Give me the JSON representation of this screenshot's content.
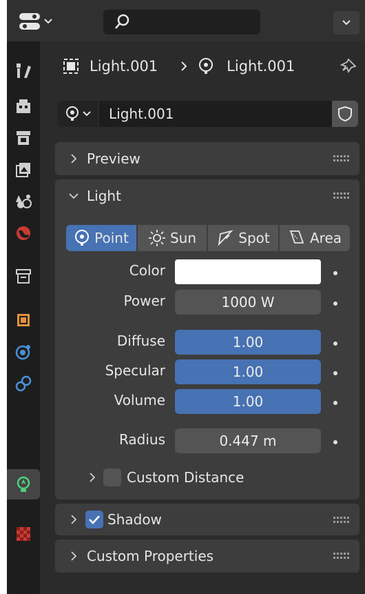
{
  "search": {
    "value": ""
  },
  "breadcrumb": {
    "object_name": "Light.001",
    "data_name": "Light.001"
  },
  "datablock": {
    "name": "Light.001"
  },
  "panels": {
    "preview": {
      "label": "Preview",
      "expanded": false
    },
    "light": {
      "label": "Light",
      "expanded": true
    },
    "shadow": {
      "label": "Shadow",
      "checked": true,
      "expanded": false
    },
    "custom_properties": {
      "label": "Custom Properties",
      "expanded": false
    }
  },
  "light": {
    "types": [
      {
        "label": "Point",
        "icon": "point-light-icon",
        "selected": true
      },
      {
        "label": "Sun",
        "icon": "sun-light-icon",
        "selected": false
      },
      {
        "label": "Spot",
        "icon": "spot-light-icon",
        "selected": false
      },
      {
        "label": "Area",
        "icon": "area-light-icon",
        "selected": false
      }
    ],
    "color": {
      "label": "Color",
      "value": "#ffffff"
    },
    "power": {
      "label": "Power",
      "value": "1000 W"
    },
    "diffuse": {
      "label": "Diffuse",
      "value": "1.00"
    },
    "specular": {
      "label": "Specular",
      "value": "1.00"
    },
    "volume": {
      "label": "Volume",
      "value": "1.00"
    },
    "radius": {
      "label": "Radius",
      "value": "0.447 m"
    },
    "custom_distance": {
      "label": "Custom Distance",
      "checked": false
    }
  },
  "colors": {
    "accent": "#4772b3",
    "panel": "#3d3d3d",
    "field": "#545454"
  }
}
